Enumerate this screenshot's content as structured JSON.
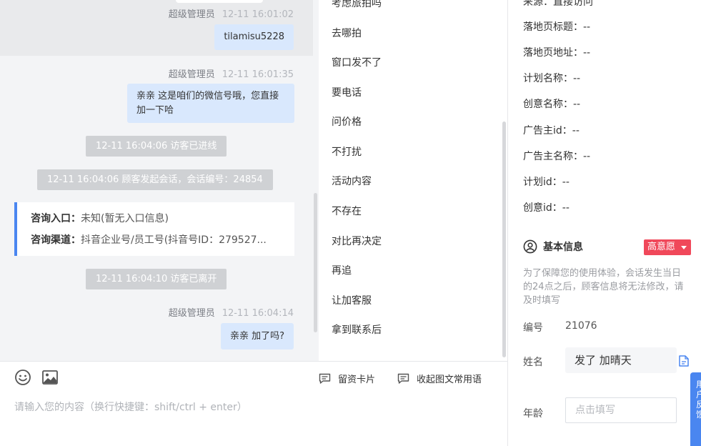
{
  "chat": {
    "messages": [
      {
        "sender": "超级管理员",
        "time": "12-11 16:01:02",
        "text": "tilamisu5228"
      },
      {
        "sender": "超级管理员",
        "time": "12-11 16:01:35",
        "text": "亲亲 这是咱们的微信号哦，您直接加一下哈"
      },
      {
        "sender": "超级管理员",
        "time": "12-11 16:04:14",
        "text": "亲亲 加了吗?"
      }
    ],
    "system": {
      "visitor_in": "12-11 16:04:06 访客已进线",
      "session_start": "12-11 16:04:06 顾客发起会话，会话编号：24854",
      "visitor_left": "12-11 16:04:10 访客已离开"
    },
    "consult": {
      "entry_label": "咨询入口：",
      "entry_value": "未知(暂无入口信息)",
      "channel_label": "咨询渠道：",
      "channel_value": "抖音企业号/员工号(抖音号ID：279527..."
    }
  },
  "phrases": {
    "items": [
      "考虑旅拍吗",
      "去哪拍",
      "窗口发不了",
      "要电话",
      "问价格",
      "不打扰",
      "活动内容",
      "不存在",
      "对比再决定",
      "再追",
      "让加客服",
      "拿到联系后"
    ]
  },
  "input": {
    "placeholder": "请输入您的内容（换行快捷键：shift/ctrl + enter）",
    "lead_card_label": "留资卡片",
    "collapse_label": "收起图文常用语",
    "emoji_icon": "emoji-icon",
    "image_icon": "image-icon"
  },
  "info": {
    "source": "来源：直接访问",
    "fields": [
      {
        "label": "落地页标题：",
        "value": "--"
      },
      {
        "label": "落地页地址：",
        "value": "--"
      },
      {
        "label": "计划名称：",
        "value": "--"
      },
      {
        "label": "创意名称：",
        "value": "--"
      },
      {
        "label": "广告主id：",
        "value": "--"
      },
      {
        "label": "广告主名称：",
        "value": "--"
      },
      {
        "label": "计划id：",
        "value": "--"
      },
      {
        "label": "创意id：",
        "value": "--"
      }
    ],
    "basic": {
      "title": "基本信息",
      "intent": "高意愿",
      "notice": "为了保障您的使用体验，会话发生当日的24点之后，顾客信息将无法修改，请及时填写",
      "id_label": "编号",
      "id_value": "21076",
      "name_label": "姓名",
      "name_value": "发了 加晴天",
      "age_label": "年龄",
      "age_placeholder": "点击填写"
    },
    "float_tab": "用户反馈"
  },
  "colors": {
    "accent": "#4a86f0",
    "bubble": "#d9e8fd",
    "intent": "#f0485a"
  }
}
